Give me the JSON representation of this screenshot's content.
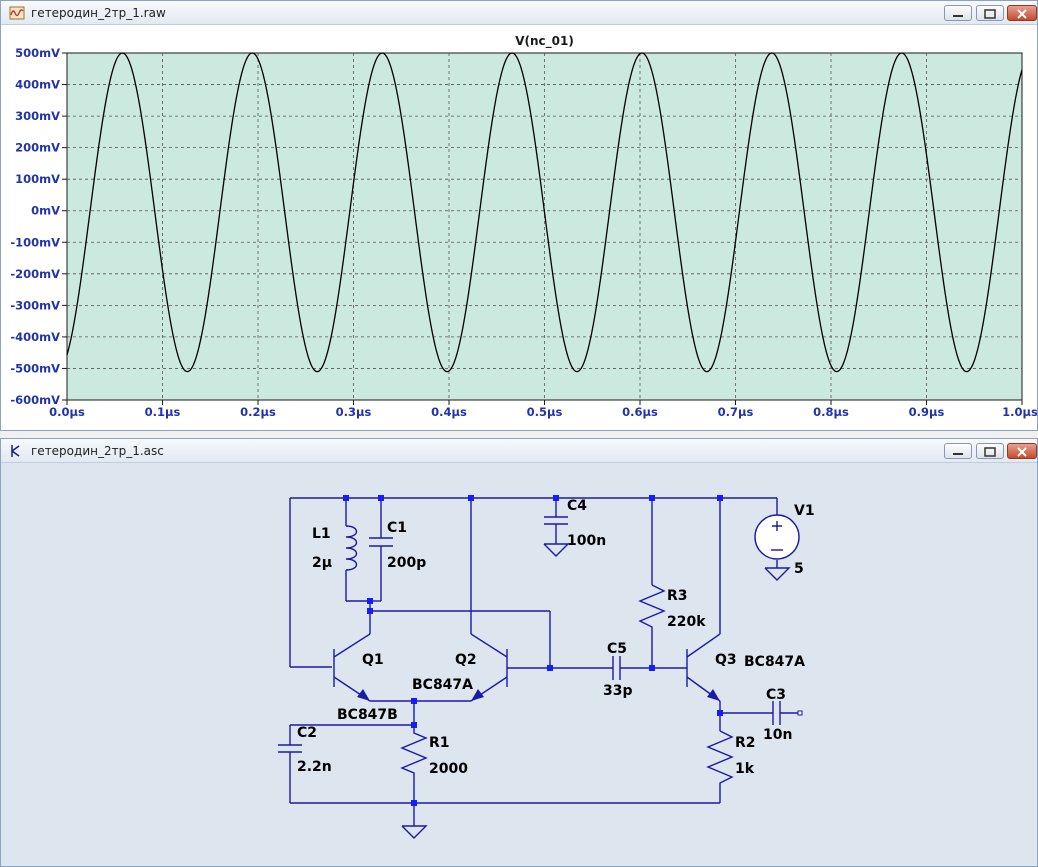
{
  "plot_window": {
    "title": "гетеродин_2тр_1.raw",
    "trace_label": "V(nc_01)",
    "y_ticks": [
      "500mV",
      "400mV",
      "300mV",
      "200mV",
      "100mV",
      "0mV",
      "-100mV",
      "-200mV",
      "-300mV",
      "-400mV",
      "-500mV",
      "-600mV"
    ],
    "x_ticks": [
      "0.0µs",
      "0.1µs",
      "0.2µs",
      "0.3µs",
      "0.4µs",
      "0.5µs",
      "0.6µs",
      "0.7µs",
      "0.8µs",
      "0.9µs",
      "1.0µs"
    ],
    "colors": {
      "plot_bg": "#cbe9df",
      "trace": "#000000",
      "tick_text": "#2233aa"
    }
  },
  "chart_data": {
    "type": "line",
    "title": "V(nc_01)",
    "xlabel": "",
    "ylabel": "",
    "x_unit": "µs",
    "y_unit": "mV",
    "xlim": [
      0,
      1.0
    ],
    "ylim": [
      -600,
      500
    ],
    "grid": true,
    "series": [
      {
        "name": "V(nc_01)",
        "waveform": "sine",
        "amplitude_mV": 505,
        "offset_mV": -5,
        "period_us": 0.136,
        "peaks_us": [
          0.058,
          0.194,
          0.33,
          0.466,
          0.602,
          0.738,
          0.874
        ],
        "troughs_us": [
          0.126,
          0.262,
          0.398,
          0.534,
          0.67,
          0.806,
          0.942
        ],
        "start_value_mV": -380,
        "end_value_mV": 450
      }
    ]
  },
  "schematic_window": {
    "title": "гетеродин_2тр_1.asc",
    "colors": {
      "bg": "#dde6ef",
      "wire": "#1a1aa8",
      "label": "#000000",
      "node": "#1a1aff"
    },
    "components": {
      "L1": {
        "name": "L1",
        "value": "2µ"
      },
      "C1": {
        "name": "C1",
        "value": "200p"
      },
      "C4": {
        "name": "C4",
        "value": "100n"
      },
      "V1": {
        "name": "V1",
        "value": "5"
      },
      "Q1": {
        "name": "Q1",
        "model": "BC847B"
      },
      "Q2": {
        "name": "Q2",
        "model": "BC847A"
      },
      "C5": {
        "name": "C5",
        "value": "33p"
      },
      "R3": {
        "name": "R3",
        "value": "220k"
      },
      "Q3": {
        "name": "Q3",
        "model": "BC847A"
      },
      "C3": {
        "name": "C3",
        "value": "10n"
      },
      "C2": {
        "name": "C2",
        "value": "2.2n"
      },
      "R1": {
        "name": "R1",
        "value": "2000"
      },
      "R2": {
        "name": "R2",
        "value": "1k"
      }
    }
  }
}
